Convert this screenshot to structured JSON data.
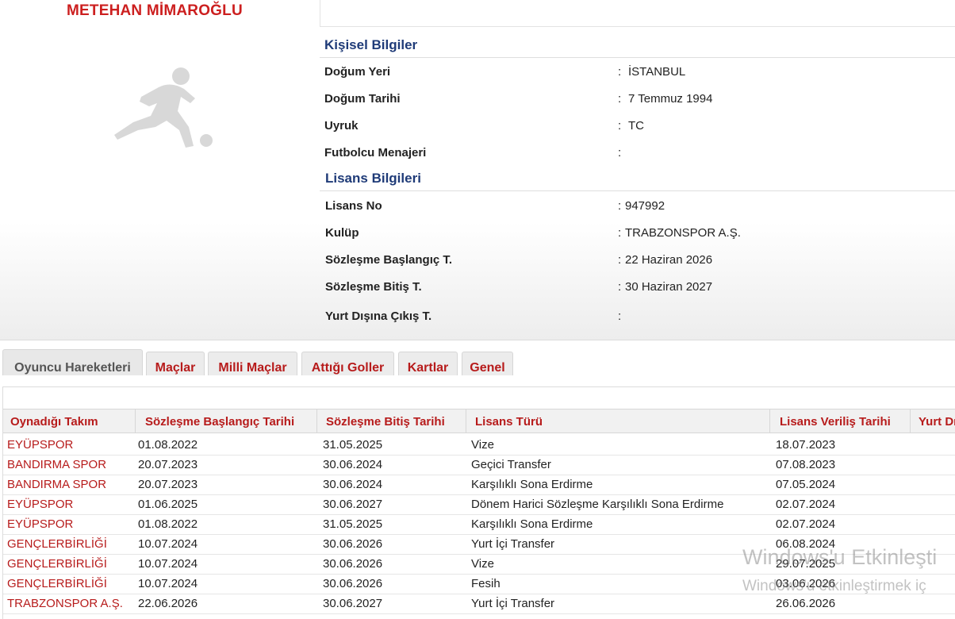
{
  "player": {
    "name": "METEHAN MİMAROĞLU"
  },
  "personal": {
    "title": "Kişisel Bilgiler",
    "rows": [
      {
        "label": "Doğum Yeri",
        "value": "İSTANBUL"
      },
      {
        "label": "Doğum Tarihi",
        "value": "7 Temmuz 1994"
      },
      {
        "label": "Uyruk",
        "value": "TC"
      },
      {
        "label": "Futbolcu Menajeri",
        "value": ""
      }
    ]
  },
  "license": {
    "title": "Lisans Bilgileri",
    "rows": [
      {
        "label": "Lisans No",
        "value": "947992"
      },
      {
        "label": "Kulüp",
        "value": "TRABZONSPOR A.Ş."
      },
      {
        "label": "Sözleşme Başlangıç T.",
        "value": "22 Haziran 2026"
      },
      {
        "label": "Sözleşme Bitiş T.",
        "value": "30 Haziran 2027"
      },
      {
        "label": "Yurt Dışına Çıkış T.",
        "value": ""
      }
    ]
  },
  "tabs": [
    {
      "label": "Oyuncu Hareketleri",
      "active": true
    },
    {
      "label": "Maçlar"
    },
    {
      "label": "Milli Maçlar"
    },
    {
      "label": "Attığı Goller"
    },
    {
      "label": "Kartlar"
    },
    {
      "label": "Genel"
    }
  ],
  "table": {
    "headers": [
      "Oynadığı Takım",
      "Sözleşme Başlangıç Tarihi",
      "Sözleşme Bitiş Tarihi",
      "Lisans Türü",
      "Lisans Veriliş Tarihi",
      "Yurt Dı"
    ],
    "rows": [
      [
        "EYÜPSPOR",
        "01.08.2022",
        "31.05.2025",
        "Vize",
        "18.07.2023"
      ],
      [
        "BANDIRMA SPOR",
        "20.07.2023",
        "30.06.2024",
        "Geçici Transfer",
        "07.08.2023"
      ],
      [
        "BANDIRMA SPOR",
        "20.07.2023",
        "30.06.2024",
        "Karşılıklı Sona Erdirme",
        "07.05.2024"
      ],
      [
        "EYÜPSPOR",
        "01.06.2025",
        "30.06.2027",
        "Dönem Harici Sözleşme Karşılıklı Sona Erdirme",
        "02.07.2024"
      ],
      [
        "EYÜPSPOR",
        "01.08.2022",
        "31.05.2025",
        "Karşılıklı Sona Erdirme",
        "02.07.2024"
      ],
      [
        "GENÇLERBİRLİĞİ",
        "10.07.2024",
        "30.06.2026",
        "Yurt İçi Transfer",
        "06.08.2024"
      ],
      [
        "GENÇLERBİRLİĞİ",
        "10.07.2024",
        "30.06.2026",
        "Vize",
        "29.07.2025"
      ],
      [
        "GENÇLERBİRLİĞİ",
        "10.07.2024",
        "30.06.2026",
        "Fesih",
        "03.06.2026"
      ],
      [
        "TRABZONSPOR A.Ş.",
        "22.06.2026",
        "30.06.2027",
        "Yurt İçi Transfer",
        "26.06.2026"
      ]
    ]
  },
  "watermark": {
    "line1": "Windows'u Etkinleşti",
    "line2": "Windows'u etkinleştirmek iç"
  },
  "colors": {
    "accent_red": "#b71b1b",
    "title_blue": "#1f3b78",
    "name_red": "#cc1f1f"
  },
  "icons": {
    "avatar": "football-player-silhouette-icon"
  }
}
